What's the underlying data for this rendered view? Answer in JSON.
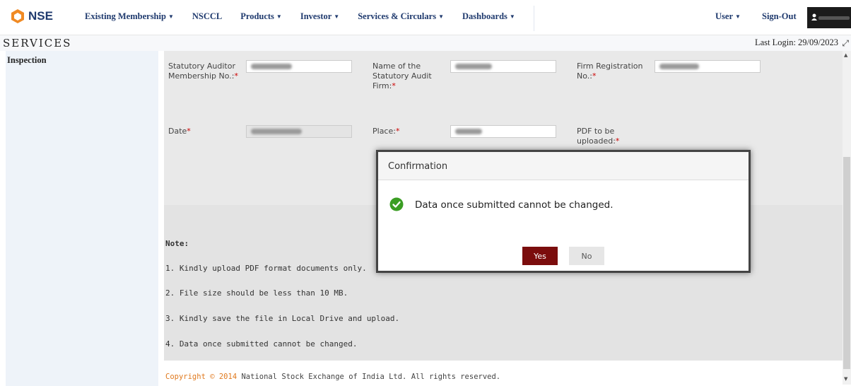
{
  "brand": {
    "name": "NSE",
    "accent": "#7b0d0d",
    "logo_orange": "#f08a24",
    "logo_blue": "#1f3a6e"
  },
  "nav": {
    "items": [
      {
        "label": "Existing Membership",
        "has_dropdown": true
      },
      {
        "label": "NSCCL",
        "has_dropdown": false
      },
      {
        "label": "Products",
        "has_dropdown": true
      },
      {
        "label": "Investor",
        "has_dropdown": true
      },
      {
        "label": "Services & Circulars",
        "has_dropdown": true
      },
      {
        "label": "Dashboards",
        "has_dropdown": true
      }
    ],
    "user_label": "User",
    "signout_label": "Sign-Out",
    "dropdown_icon": "caret-down-icon",
    "user_icon": "user-icon"
  },
  "header": {
    "section_title": "SERVICES",
    "last_login": "Last Login: 29/09/2023"
  },
  "sidebar": {
    "items": [
      {
        "label": "Inspection"
      }
    ]
  },
  "form": {
    "auditor_membership_label": "Statutory Auditor Membership No.:",
    "audit_firm_label": "Name of the Statutory Audit Firm:",
    "firm_registration_label": "Firm Registration No.:",
    "date_label": "Date",
    "place_label": "Place:",
    "pdf_label": "PDF to be uploaded:",
    "required_mark": "*"
  },
  "notes": {
    "title": "Note:",
    "items": [
      "1. Kindly upload PDF format documents only.",
      "2. File size should be less than 10 MB.",
      "3. Kindly save the file in Local Drive and upload.",
      "4. Data once submitted cannot be changed."
    ]
  },
  "footer": {
    "copyright_prefix": "Copyright © 2014",
    "copyright_rest": " National Stock Exchange of India Ltd. All rights reserved."
  },
  "dialog": {
    "title": "Confirmation",
    "message": "Data once submitted cannot be changed.",
    "yes_label": "Yes",
    "no_label": "No",
    "icon": "check-circle-icon",
    "icon_color": "#3a9d23"
  }
}
